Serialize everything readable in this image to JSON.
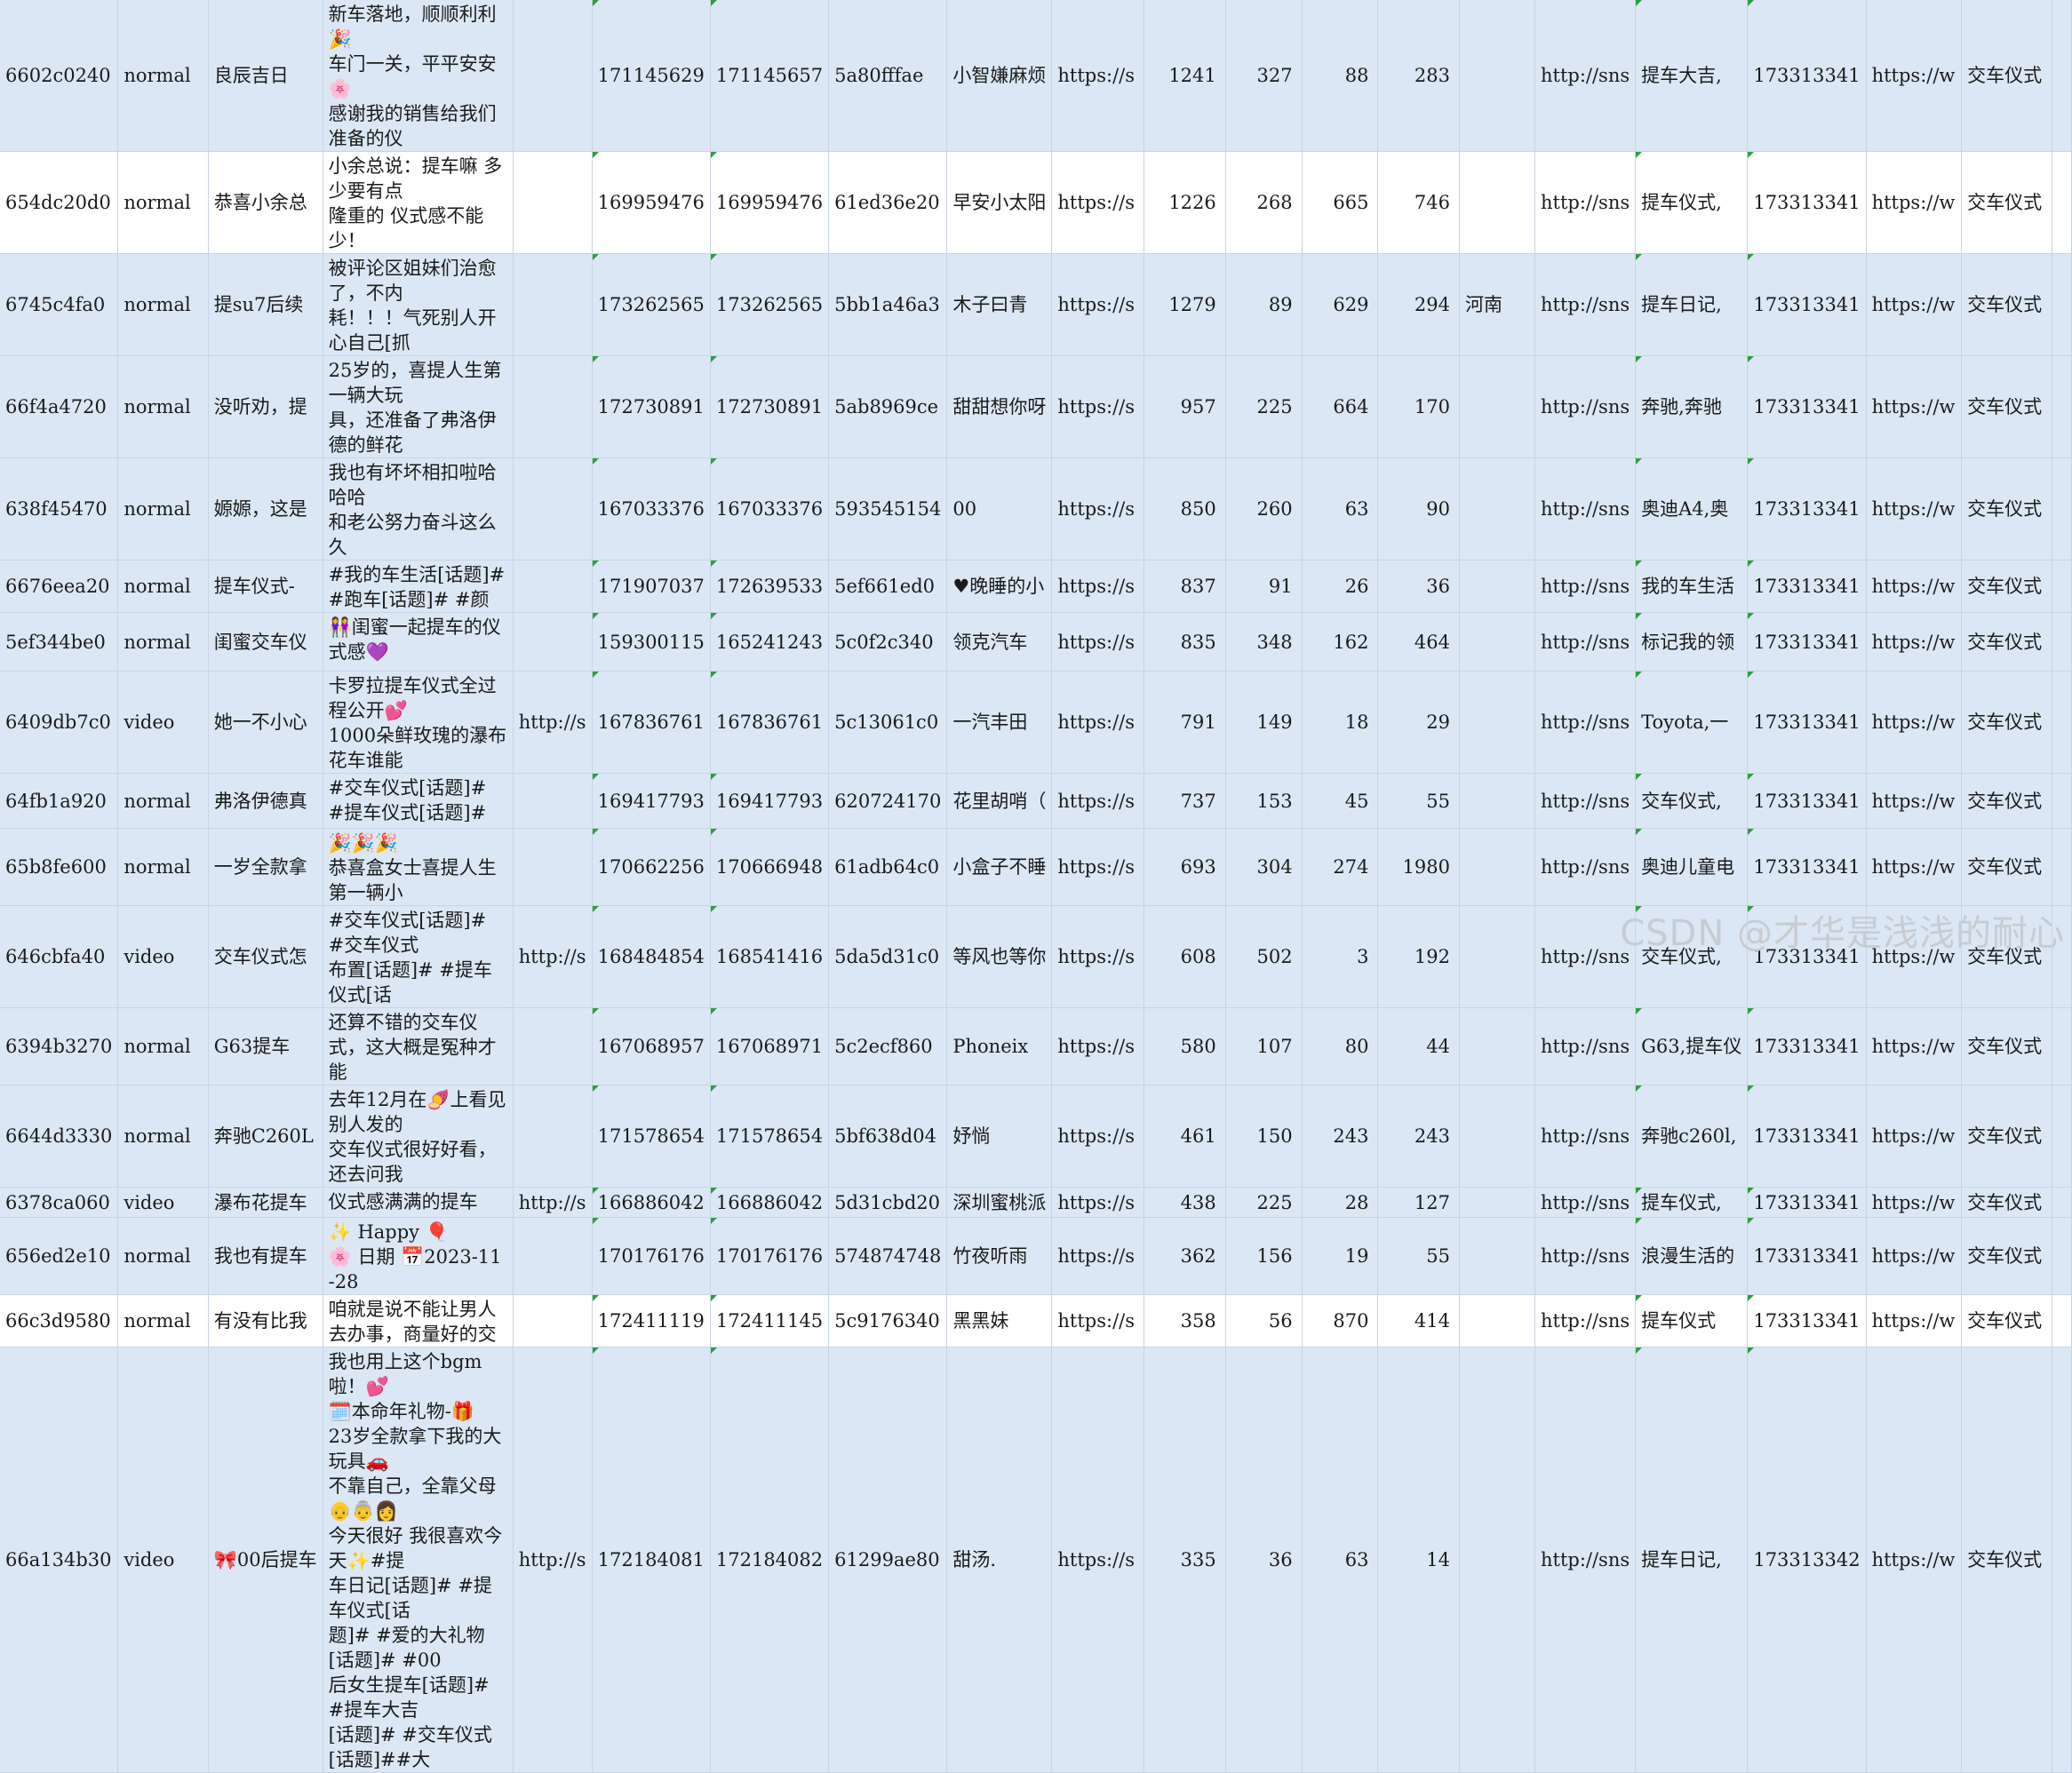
{
  "sheet": {
    "rows": [
      {
        "id": "6602c0240",
        "type": "normal",
        "title": "良辰吉日",
        "desc": "新车落地，顺顺利利🎉\n车门一关，平平安安🌸\n感谢我的销售给我们准备的仪",
        "media": "",
        "t1": "171145629",
        "t2": "171145657",
        "uid": "5a80fffae",
        "nick": "小智嫌麻烦",
        "link": "https://s",
        "likes": "1241",
        "collects": "327",
        "comments": "88",
        "shares": "283",
        "loc": "",
        "cover": "http://sns",
        "tags": "提车大吉,",
        "sid": "173313341",
        "url2": "https://w",
        "kw": "交车仪式"
      },
      {
        "id": "654dc20d0",
        "type": "normal",
        "title": "恭喜小余总",
        "desc": "小余总说：提车嘛 多少要有点\n隆重的 仪式感不能少！",
        "media": "",
        "t1": "169959476",
        "t2": "169959476",
        "uid": "61ed36e20",
        "nick": "早安小太阳",
        "link": "https://s",
        "likes": "1226",
        "collects": "268",
        "comments": "665",
        "shares": "746",
        "loc": "",
        "cover": "http://sns",
        "tags": "提车仪式,",
        "sid": "173313341",
        "url2": "https://w",
        "kw": "交车仪式"
      },
      {
        "id": "6745c4fa0",
        "type": "normal",
        "title": "提su7后续",
        "desc": "被评论区姐妹们治愈了，不内\n耗！！！气死别人开心自己[抓",
        "media": "",
        "t1": "173262565",
        "t2": "173262565",
        "uid": "5bb1a46a3",
        "nick": "木子曰青",
        "link": "https://s",
        "likes": "1279",
        "collects": "89",
        "comments": "629",
        "shares": "294",
        "loc": "河南",
        "cover": "http://sns",
        "tags": "提车日记,",
        "sid": "173313341",
        "url2": "https://w",
        "kw": "交车仪式"
      },
      {
        "id": "66f4a4720",
        "type": "normal",
        "title": "没听劝，提",
        "desc": "25岁的，喜提人生第一辆大玩\n具，还准备了弗洛伊德的鲜花",
        "media": "",
        "t1": "172730891",
        "t2": "172730891",
        "uid": "5ab8969ce",
        "nick": "甜甜想你呀",
        "link": "https://s",
        "likes": "957",
        "collects": "225",
        "comments": "664",
        "shares": "170",
        "loc": "",
        "cover": "http://sns",
        "tags": "奔驰,奔驰",
        "sid": "173313341",
        "url2": "https://w",
        "kw": "交车仪式"
      },
      {
        "id": "638f45470",
        "type": "normal",
        "title": "嫄嫄，这是",
        "desc": "我也有坏坏相扣啦哈哈哈\n和老公努力奋斗这么久",
        "media": "",
        "t1": "167033376",
        "t2": "167033376",
        "uid": "593545154",
        "nick": "00",
        "link": "https://s",
        "likes": "850",
        "collects": "260",
        "comments": "63",
        "shares": "90",
        "loc": "",
        "cover": "http://sns",
        "tags": "奥迪A4,奥",
        "sid": "173313341",
        "url2": "https://w",
        "kw": "交车仪式"
      },
      {
        "id": "6676eea20",
        "type": "normal",
        "title": "提车仪式-",
        "desc": "#我的车生活[话题]# #跑车[话题]# #颜",
        "media": "",
        "t1": "171907037",
        "t2": "172639533",
        "uid": "5ef661ed0",
        "nick": "♥晚睡的小",
        "link": "https://s",
        "likes": "837",
        "collects": "91",
        "comments": "26",
        "shares": "36",
        "loc": "",
        "cover": "http://sns",
        "tags": "我的车生活",
        "sid": "173313341",
        "url2": "https://w",
        "kw": "交车仪式"
      },
      {
        "id": "5ef344be0",
        "type": "normal",
        "title": "闺蜜交车仪",
        "desc": "👭闺蜜一起提车的仪式感💜",
        "media": "",
        "t1": "159300115",
        "t2": "165241243",
        "uid": "5c0f2c340",
        "nick": "领克汽车",
        "link": "https://s",
        "likes": "835",
        "collects": "348",
        "comments": "162",
        "shares": "464",
        "loc": "",
        "cover": "http://sns",
        "tags": "标记我的领",
        "sid": "173313341",
        "url2": "https://w",
        "kw": "交车仪式"
      },
      {
        "id": "6409db7c0",
        "type": "video",
        "title": "她一不小心",
        "desc": "卡罗拉提车仪式全过程公开💕\n1000朵鲜玫瑰的瀑布花车谁能",
        "media": "http://s",
        "t1": "167836761",
        "t2": "167836761",
        "uid": "5c13061c0",
        "nick": "一汽丰田",
        "link": "https://s",
        "likes": "791",
        "collects": "149",
        "comments": "18",
        "shares": "29",
        "loc": "",
        "cover": "http://sns",
        "tags": "Toyota,一",
        "sid": "173313341",
        "url2": "https://w",
        "kw": "交车仪式"
      },
      {
        "id": "64fb1a920",
        "type": "normal",
        "title": "弗洛伊德真",
        "desc": "#交车仪式[话题]# #提车仪式[话题]#",
        "media": "",
        "t1": "169417793",
        "t2": "169417793",
        "uid": "620724170",
        "nick": "花里胡哨（",
        "link": "https://s",
        "likes": "737",
        "collects": "153",
        "comments": "45",
        "shares": "55",
        "loc": "",
        "cover": "http://sns",
        "tags": "交车仪式,",
        "sid": "173313341",
        "url2": "https://w",
        "kw": "交车仪式"
      },
      {
        "id": "65b8fe600",
        "type": "normal",
        "title": "一岁全款拿",
        "desc": "🎉🎉🎉\n恭喜盒女士喜提人生第一辆小",
        "media": "",
        "t1": "170662256",
        "t2": "170666948",
        "uid": "61adb64c0",
        "nick": "小盒子不睡",
        "link": "https://s",
        "likes": "693",
        "collects": "304",
        "comments": "274",
        "shares": "1980",
        "loc": "",
        "cover": "http://sns",
        "tags": "奥迪儿童电",
        "sid": "173313341",
        "url2": "https://w",
        "kw": "交车仪式"
      },
      {
        "id": "646cbfa40",
        "type": "video",
        "title": "交车仪式怎",
        "desc": "#交车仪式[话题]# #交车仪式\n布置[话题]# #提车仪式[话",
        "media": "http://s",
        "t1": "168484854",
        "t2": "168541416",
        "uid": "5da5d31c0",
        "nick": "等风也等你",
        "link": "https://s",
        "likes": "608",
        "collects": "502",
        "comments": "3",
        "shares": "192",
        "loc": "",
        "cover": "http://sns",
        "tags": "交车仪式,",
        "sid": "173313341",
        "url2": "https://w",
        "kw": "交车仪式"
      },
      {
        "id": "6394b3270",
        "type": "normal",
        "title": "G63提车",
        "desc": "还算不错的交车仪式，这大概是冤种才能",
        "media": "",
        "t1": "167068957",
        "t2": "167068971",
        "uid": "5c2ecf860",
        "nick": "Phoneix",
        "link": "https://s",
        "likes": "580",
        "collects": "107",
        "comments": "80",
        "shares": "44",
        "loc": "",
        "cover": "http://sns",
        "tags": "G63,提车仪",
        "sid": "173313341",
        "url2": "https://w",
        "kw": "交车仪式"
      },
      {
        "id": "6644d3330",
        "type": "normal",
        "title": "奔驰C260L",
        "desc": "去年12月在🍠上看见别人发的\n交车仪式很好好看，还去问我",
        "media": "",
        "t1": "171578654",
        "t2": "171578654",
        "uid": "5bf638d04",
        "nick": "妤惝",
        "link": "https://s",
        "likes": "461",
        "collects": "150",
        "comments": "243",
        "shares": "243",
        "loc": "",
        "cover": "http://sns",
        "tags": "奔驰c260l,",
        "sid": "173313341",
        "url2": "https://w",
        "kw": "交车仪式"
      },
      {
        "id": "6378ca060",
        "type": "video",
        "title": "瀑布花提车",
        "desc": "仪式感满满的提车",
        "media": "http://s",
        "t1": "166886042",
        "t2": "166886042",
        "uid": "5d31cbd20",
        "nick": "深圳蜜桃派",
        "link": "https://s",
        "likes": "438",
        "collects": "225",
        "comments": "28",
        "shares": "127",
        "loc": "",
        "cover": "http://sns",
        "tags": "提车仪式,",
        "sid": "173313341",
        "url2": "https://w",
        "kw": "交车仪式"
      },
      {
        "id": "656ed2e10",
        "type": "normal",
        "title": "我也有提车",
        "desc": "✨ Happy 🎈\n🌸 日期 📅2023-11-28",
        "media": "",
        "t1": "170176176",
        "t2": "170176176",
        "uid": "574874748",
        "nick": "竹夜听雨",
        "link": "https://s",
        "likes": "362",
        "collects": "156",
        "comments": "19",
        "shares": "55",
        "loc": "",
        "cover": "http://sns",
        "tags": "浪漫生活的",
        "sid": "173313341",
        "url2": "https://w",
        "kw": "交车仪式"
      },
      {
        "id": "66c3d9580",
        "type": "normal",
        "title": "有没有比我",
        "desc": "咱就是说不能让男人去办事，商量好的交",
        "media": "",
        "t1": "172411119",
        "t2": "172411145",
        "uid": "5c9176340",
        "nick": "黑黑妹",
        "link": "https://s",
        "likes": "358",
        "collects": "56",
        "comments": "870",
        "shares": "414",
        "loc": "",
        "cover": "http://sns",
        "tags": "提车仪式",
        "sid": "173313341",
        "url2": "https://w",
        "kw": "交车仪式"
      },
      {
        "id": "66a134b30",
        "type": "video",
        "title": "🎀00后提车",
        "desc": "我也用上这个bgm啦！💕\n🗓️本命年礼物-🎁\n23岁全款拿下我的大玩具🚗\n不靠自己，全靠父母👴👵👩\n今天很好 我很喜欢今天✨#提\n车日记[话题]# #提车仪式[话\n题]# #爱的大礼物[话题]# #00\n后女生提车[话题]# #提车大吉\n[话题]# #交车仪式[话题]##大",
        "media": "http://s",
        "t1": "172184081",
        "t2": "172184082",
        "uid": "61299ae80",
        "nick": "甜汤.",
        "link": "https://s",
        "likes": "335",
        "collects": "36",
        "comments": "63",
        "shares": "14",
        "loc": "",
        "cover": "http://sns",
        "tags": "提车日记,",
        "sid": "173313342",
        "url2": "https://w",
        "kw": "交车仪式"
      }
    ]
  },
  "watermark": "CSDN @才华是浅浅的耐心"
}
